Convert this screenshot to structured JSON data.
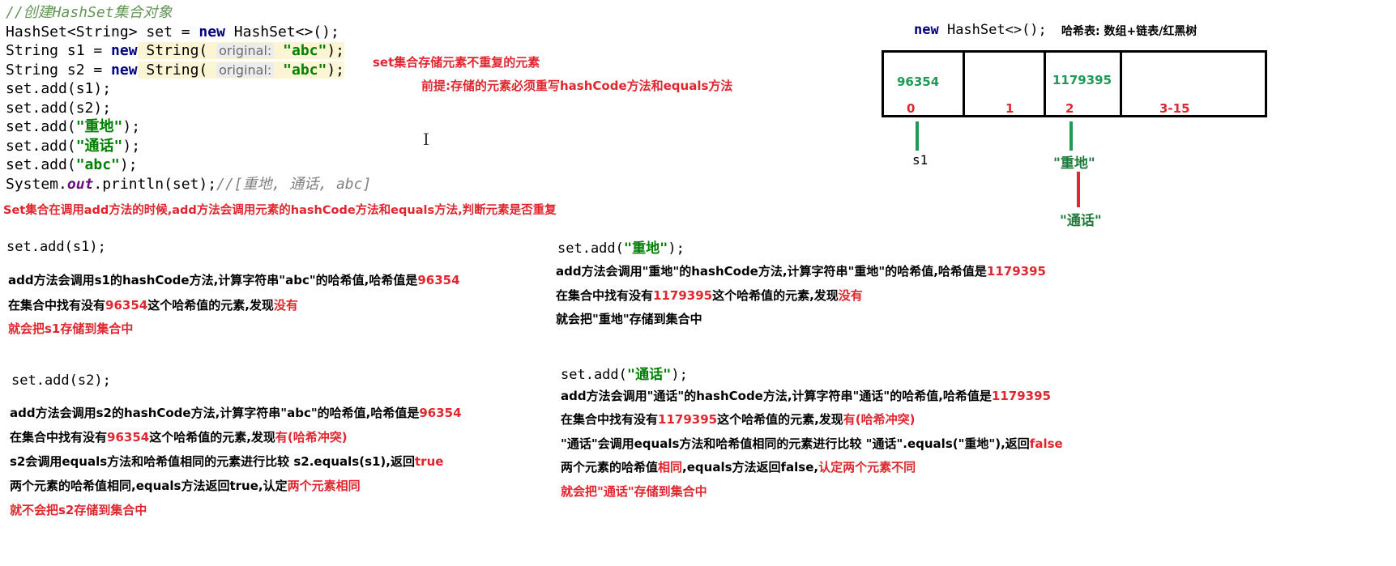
{
  "code": {
    "comment": "//创建HashSet集合对象",
    "line1_a": "HashSet<String> set = ",
    "line1_new": "new",
    "line1_b": " HashSet<>();",
    "line2_a": "String s1 = ",
    "line2_new": "new",
    "line2_b": " String(",
    "hint": "original:",
    "str_abc": "\"abc\"",
    "close": ");",
    "line3_a": "String s2 = ",
    "add_s1": "set.add(s1);",
    "add_s2": "set.add(s2);",
    "add_pre": "set.add(",
    "str_zhongdi": "\"重地\"",
    "str_tonghua": "\"通话\"",
    "println_a": "System.",
    "println_out": "out",
    "println_b": ".println(set);",
    "println_cmt": "//[重地, 通话, abc]"
  },
  "top_notes": {
    "title": "set集合存储元素不重复的元素",
    "premise": "前提:存储的元素必须重写hashCode方法和equals方法"
  },
  "diagram": {
    "code_new": "new",
    "code_rest": " HashSet<>();",
    "label": "哈希表: 数组+链表/红黑树",
    "cells": [
      {
        "value": "96354",
        "index": "0"
      },
      {
        "value": "",
        "index": "1"
      },
      {
        "value": "1179395",
        "index": "2"
      },
      {
        "value": "",
        "index": "3-15"
      }
    ],
    "s1": "s1",
    "node_zhongdi": "\"重地\"",
    "node_tonghua": "\"通话\""
  },
  "set_note": "Set集合在调用add方法的时候,add方法会调用元素的hashCode方法和equals方法,判断元素是否重复",
  "block_s1": {
    "code": "set.add(s1);",
    "l1_a": "add方法会调用s1的hashCode方法,计算字符串\"abc\"的哈希值,哈希值是",
    "l1_v": "96354",
    "l2_a": "在集合中找有没有",
    "l2_v": "96354",
    "l2_b": "这个哈希值的元素,发现",
    "l2_c": "没有",
    "l3": "就会把s1存储到集合中"
  },
  "block_s2": {
    "code": "set.add(s2);",
    "l1_a": "add方法会调用s2的hashCode方法,计算字符串\"abc\"的哈希值,哈希值是",
    "l1_v": "96354",
    "l2_a": "在集合中找有没有",
    "l2_v": "96354",
    "l2_b": "这个哈希值的元素,发现",
    "l2_c": "有(哈希冲突)",
    "l3_a": "s2会调用equals方法和哈希值相同的元素进行比较 s2.equals(s1),返回",
    "l3_v": "true",
    "l4_a": "两个元素的哈希值相同,equals方法返回true,认定",
    "l4_v": "两个元素相同",
    "l5": "就不会把s2存储到集合中"
  },
  "block_zhongdi": {
    "code_a": "set.add(",
    "code_s": "\"重地\"",
    "code_b": ");",
    "l1_a": "add方法会调用\"重地\"的hashCode方法,计算字符串\"重地\"的哈希值,哈希值是",
    "l1_v": "1179395",
    "l2_a": "在集合中找有没有",
    "l2_v": "1179395",
    "l2_b": "这个哈希值的元素,发现",
    "l2_c": "没有",
    "l3": "就会把\"重地\"存储到集合中"
  },
  "block_tonghua": {
    "code_a": "set.add(",
    "code_s": "\"通话\"",
    "code_b": ");",
    "l1_a": "add方法会调用\"通话\"的hashCode方法,计算字符串\"通话\"的哈希值,哈希值是",
    "l1_v": "1179395",
    "l2_a": "在集合中找有没有",
    "l2_v": "1179395",
    "l2_b": "这个哈希值的元素,发现",
    "l2_c": "有(哈希冲突)",
    "l3_a": "\"通话\"会调用equals方法和哈希值相同的元素进行比较 \"通话\".equals(\"重地\"),返回",
    "l3_v": "false",
    "l4_a": "两个元素的哈希值",
    "l4_v1": "相同",
    "l4_b": ",equals方法返回false,",
    "l4_v2": "认定两个元素不同",
    "l5": "就会把\"通话\"存储到集合中"
  },
  "colors": {
    "accent_red": "#e0262e",
    "hash_green": "#1e9a55",
    "keyword": "#000080",
    "string": "#008000"
  }
}
